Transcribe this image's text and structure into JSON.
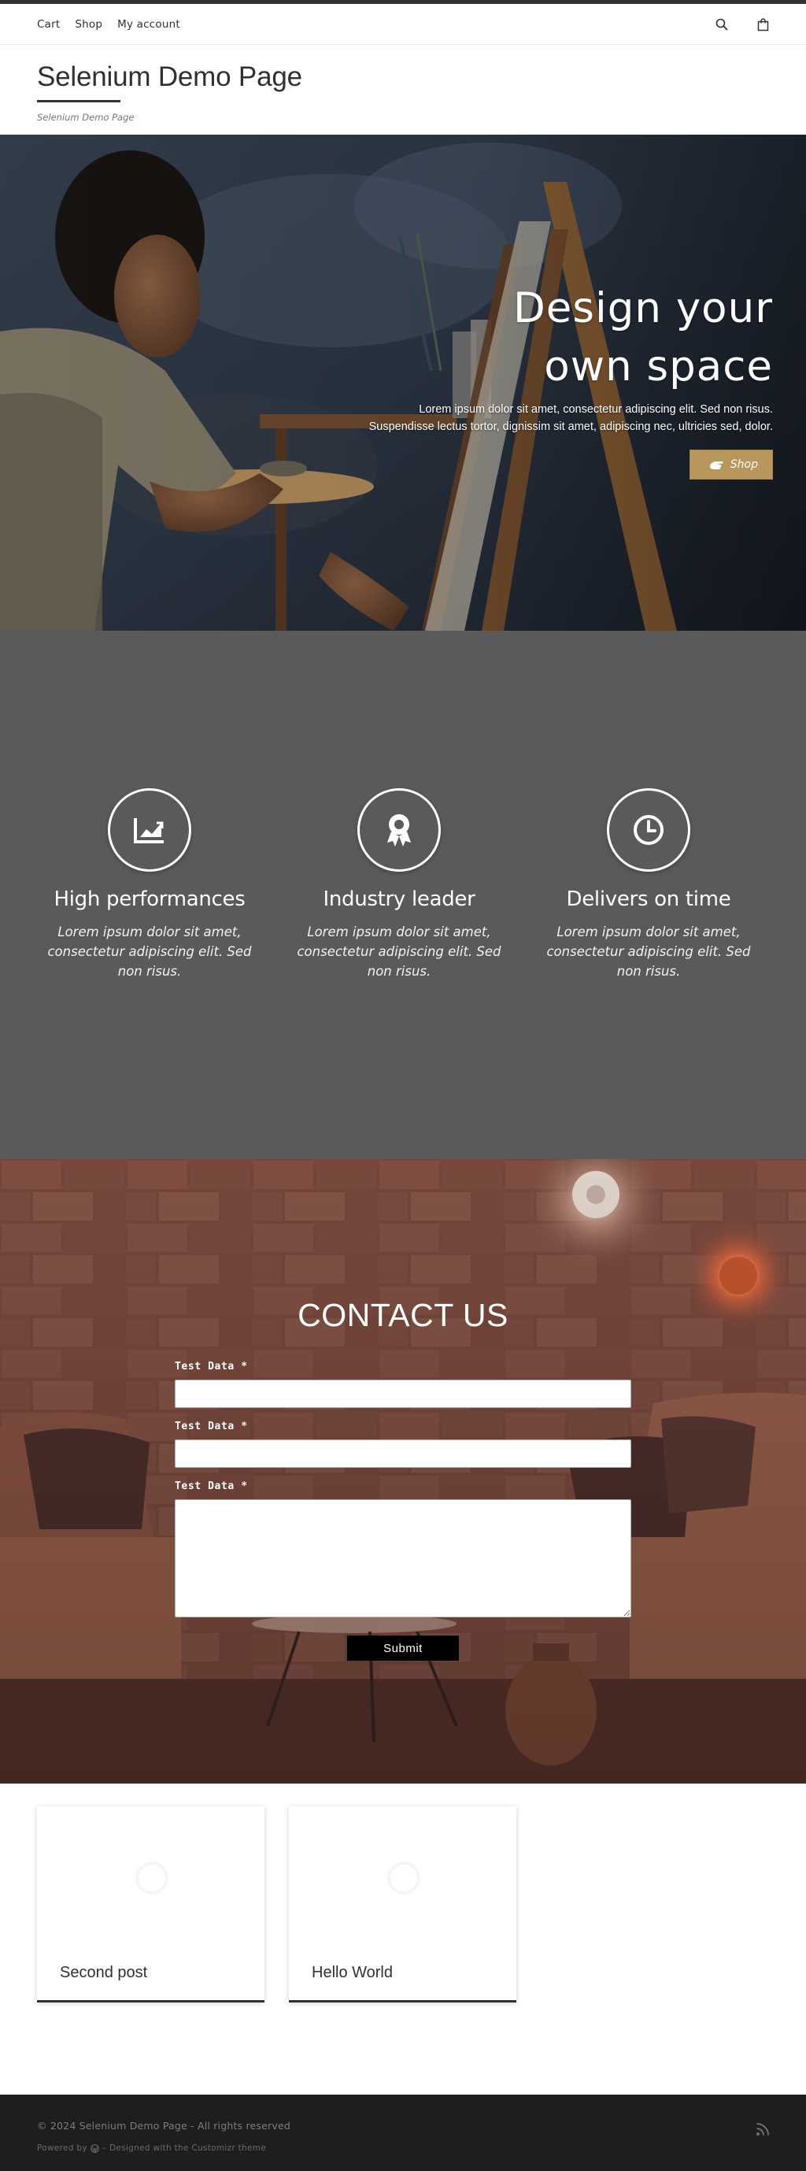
{
  "nav": {
    "items": [
      "Cart",
      "Shop",
      "My account"
    ],
    "search_icon": "search-icon",
    "cart_icon": "shopping-bag-icon"
  },
  "branding": {
    "title": "Selenium Demo Page",
    "tagline": "Selenium Demo Page"
  },
  "hero": {
    "title_line1": "Design your",
    "title_line2": "own space",
    "text": "Lorem ipsum dolor sit amet, consectetur adipiscing elit. Sed non risus. Suspendisse lectus tortor, dignissim sit amet, adipiscing nec, ultricies sed, dolor.",
    "button_label": "Shop",
    "button_icon": "hand-pointer-icon",
    "button_color": "#b9965b"
  },
  "features": [
    {
      "icon": "line-chart-icon",
      "title": "High performances",
      "text": "Lorem ipsum dolor sit amet, consectetur adipiscing elit. Sed non risus."
    },
    {
      "icon": "award-icon",
      "title": "Industry leader",
      "text": "Lorem ipsum dolor sit amet, consectetur adipiscing elit. Sed non risus."
    },
    {
      "icon": "clock-icon",
      "title": "Delivers on time",
      "text": "Lorem ipsum dolor sit amet, consectetur adipiscing elit. Sed non risus."
    }
  ],
  "contact": {
    "title": "CONTACT US",
    "field1_label": "Test Data *",
    "field1_value": "",
    "field2_label": "Test Data *",
    "field2_value": "",
    "field3_label": "Test Data *",
    "field3_value": "",
    "submit_label": "Submit"
  },
  "posts": [
    {
      "title": "Second post"
    },
    {
      "title": "Hello World"
    }
  ],
  "footer": {
    "copyright": "© 2024 Selenium Demo Page - All rights reserved",
    "powered_prefix": "Powered by",
    "powered_suffix": "– Designed with the Customizr theme",
    "rss_icon": "rss-icon"
  },
  "colors": {
    "accent": "#b9965b",
    "dark": "#313131",
    "features_bg": "#5a5a5a",
    "footer_bg": "#1e1e1e"
  }
}
